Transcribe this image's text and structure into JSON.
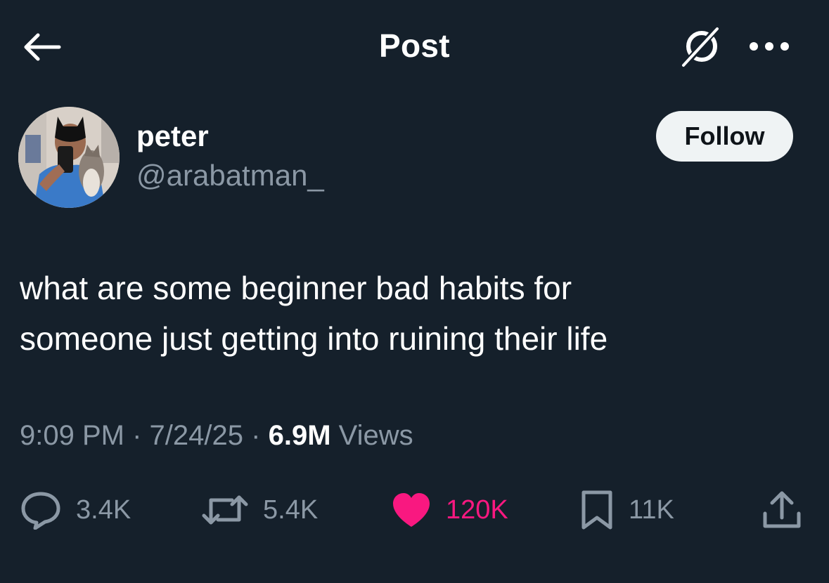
{
  "header": {
    "title": "Post",
    "icons": {
      "back": "arrow-left-icon",
      "grok": "grok-icon",
      "more": "more-horizontal-icon"
    }
  },
  "author": {
    "name": "peter",
    "handle": "@arabatman_",
    "follow_label": "Follow"
  },
  "tweet": {
    "text_line1": "what are some beginner bad habits for",
    "text_line2": "someone just getting into ruining their life"
  },
  "meta": {
    "time": "9:09 PM",
    "date": "7/24/25",
    "views_count": "6.9M",
    "views_label": "Views",
    "separator": "·"
  },
  "actions": {
    "replies": "3.4K",
    "reposts": "5.4K",
    "likes": "120K",
    "bookmarks": "11K"
  },
  "colors": {
    "background": "#15202b",
    "secondary_text": "#8b98a5",
    "like_pink": "#f91880",
    "follow_bg": "#eff3f4"
  }
}
